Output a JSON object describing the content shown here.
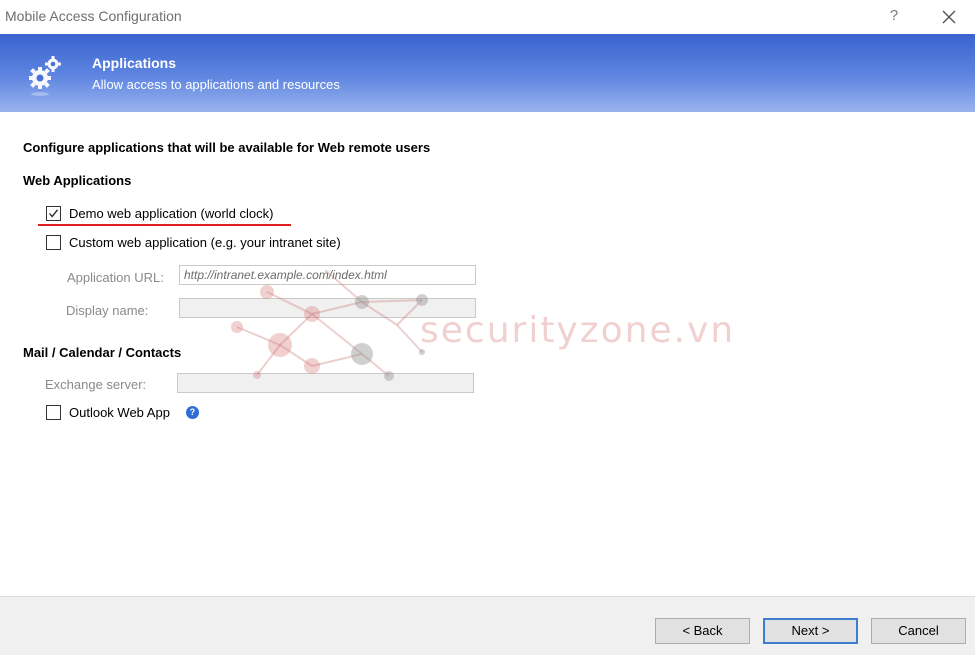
{
  "window": {
    "title": "Mobile Access Configuration",
    "help_label": "?",
    "close_icon": "close-icon"
  },
  "banner": {
    "icon": "gears-icon",
    "title": "Applications",
    "subtitle": "Allow access to applications and resources",
    "gradient_top": "#3a63cf",
    "gradient_bottom": "#9ab3ee"
  },
  "main": {
    "heading": "Configure applications that will be available for Web remote users",
    "web_apps": {
      "title": "Web Applications",
      "demo_checkbox": {
        "label": "Demo web application (world clock)",
        "checked": true
      },
      "custom_checkbox": {
        "label": "Custom web application (e.g. your intranet site)",
        "checked": false
      },
      "app_url_label": "Application URL:",
      "app_url_placeholder": "http://intranet.example.com/index.html",
      "display_name_label": "Display name:",
      "display_name_value": ""
    },
    "mail": {
      "title": "Mail / Calendar / Contacts",
      "exchange_label": "Exchange server:",
      "exchange_value": "",
      "owa_checkbox": {
        "label": "Outlook Web App",
        "checked": false
      },
      "help_icon": "?"
    },
    "highlight_color": "#e02020"
  },
  "watermark": {
    "text": "securityzone.vn"
  },
  "footer": {
    "back_label": "< Back",
    "next_label": "Next >",
    "cancel_label": "Cancel"
  }
}
